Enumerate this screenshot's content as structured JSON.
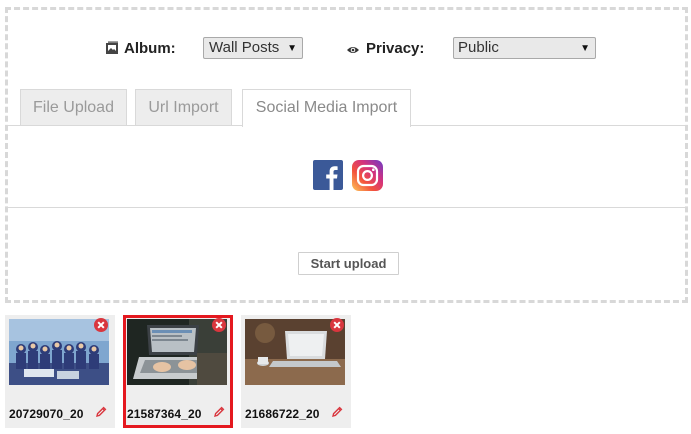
{
  "upload": {
    "album": {
      "label": "Album:",
      "value": "Wall Posts",
      "icon": "photo-album-icon"
    },
    "privacy": {
      "label": "Privacy:",
      "value": "Public",
      "icon": "eye-icon"
    },
    "tabs": [
      {
        "label": "File Upload",
        "active": false
      },
      {
        "label": "Url Import",
        "active": false
      },
      {
        "label": "Social Media Import",
        "active": true
      }
    ],
    "social_icons": [
      "facebook-icon",
      "instagram-icon"
    ],
    "start_button": "Start upload"
  },
  "thumbnails": [
    {
      "name": "20729070_20",
      "image": "group-photo",
      "selected": false
    },
    {
      "name": "21587364_20",
      "image": "laptop-hands",
      "selected": true
    },
    {
      "name": "21686722_20",
      "image": "laptop-table",
      "selected": false
    }
  ],
  "colors": {
    "remove": "#d9363e",
    "edit": "#d9363e",
    "selection": "#e4181f",
    "facebook": "#3b5998"
  }
}
